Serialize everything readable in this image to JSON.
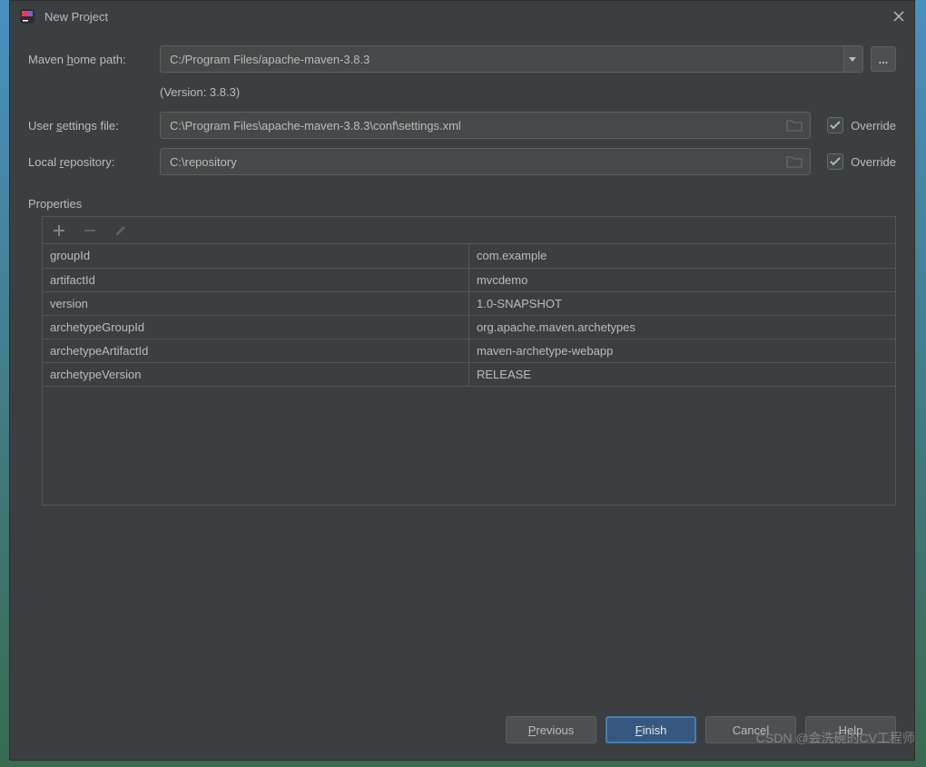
{
  "window": {
    "title": "New Project"
  },
  "form": {
    "maven_home_label_prefix": "Maven ",
    "maven_home_label_u": "h",
    "maven_home_label_suffix": "ome path:",
    "maven_home_value": "C:/Program Files/apache-maven-3.8.3",
    "version_note": "(Version: 3.8.3)",
    "settings_label_prefix": "User ",
    "settings_label_u": "s",
    "settings_label_suffix": "ettings file:",
    "settings_value": "C:\\Program Files\\apache-maven-3.8.3\\conf\\settings.xml",
    "repo_label_prefix": "Local ",
    "repo_label_u": "r",
    "repo_label_suffix": "epository:",
    "repo_value": "C:\\repository",
    "override_label": "Override",
    "browse_label": "..."
  },
  "properties": {
    "section_label": "Properties",
    "rows": [
      {
        "key": "groupId",
        "value": "com.example"
      },
      {
        "key": "artifactId",
        "value": "mvcdemo"
      },
      {
        "key": "version",
        "value": "1.0-SNAPSHOT"
      },
      {
        "key": "archetypeGroupId",
        "value": "org.apache.maven.archetypes"
      },
      {
        "key": "archetypeArtifactId",
        "value": "maven-archetype-webapp"
      },
      {
        "key": "archetypeVersion",
        "value": "RELEASE"
      }
    ]
  },
  "buttons": {
    "previous_u": "P",
    "previous_rest": "revious",
    "finish_u": "F",
    "finish_rest": "inish",
    "cancel": "Cancel",
    "help": "Help"
  },
  "watermark": "CSDN @会洗碗的CV工程师"
}
